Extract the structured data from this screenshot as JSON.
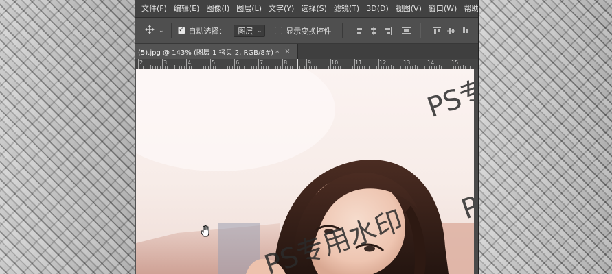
{
  "menu": {
    "items": [
      "文件(F)",
      "编辑(E)",
      "图像(I)",
      "图层(L)",
      "文字(Y)",
      "选择(S)",
      "滤镜(T)",
      "3D(D)",
      "视图(V)",
      "窗口(W)",
      "帮助(H)"
    ]
  },
  "options": {
    "auto_select_label": "自动选择：",
    "auto_select_checked": true,
    "auto_select_target": "图层",
    "show_transform_label": "显示变换控件",
    "show_transform_checked": false
  },
  "document": {
    "tab_title": "(5).jpg @ 143% (图层 1 拷贝 2, RGB/8#) *",
    "close_glyph": "×"
  },
  "ruler": {
    "labels": [
      "2",
      "3",
      "4",
      "5",
      "6",
      "7",
      "8",
      "9",
      "10",
      "11",
      "12",
      "13",
      "14",
      "15"
    ]
  },
  "canvas": {
    "watermark_text": "PS专用水印",
    "watermark_partial_top": "PS专",
    "watermark_partial_right": "P"
  },
  "icons": {
    "move": "move-arrows-icon",
    "hand": "hand-cursor-icon"
  }
}
